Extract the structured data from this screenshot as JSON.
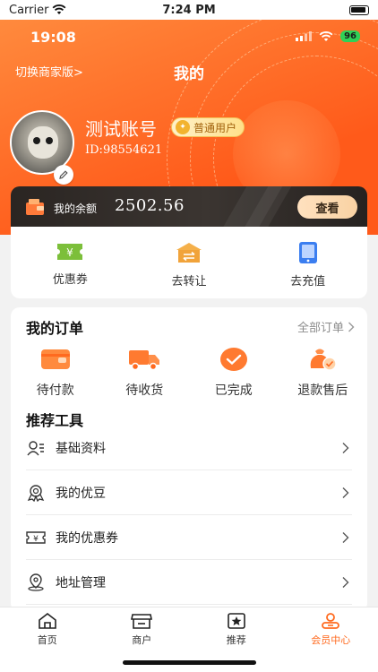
{
  "simulator": {
    "carrier": "Carrier",
    "time": "7:24 PM"
  },
  "inner_status": {
    "time": "19:08",
    "battery": "96"
  },
  "header": {
    "switch_link": "切换商家版>",
    "title": "我的"
  },
  "user": {
    "name": "测试账号",
    "badge": "普通用户",
    "id": "ID:98554621"
  },
  "balance": {
    "label": "我的余额",
    "value": "2502.56",
    "view_button": "查看"
  },
  "quick_actions": [
    {
      "label": "优惠券",
      "icon": "coupon-icon"
    },
    {
      "label": "去转让",
      "icon": "transfer-icon"
    },
    {
      "label": "去充值",
      "icon": "recharge-icon"
    }
  ],
  "orders": {
    "title": "我的订单",
    "all_link": "全部订单",
    "items": [
      {
        "label": "待付款",
        "icon": "wallet-icon"
      },
      {
        "label": "待收货",
        "icon": "truck-icon"
      },
      {
        "label": "已完成",
        "icon": "check-icon"
      },
      {
        "label": "退款售后",
        "icon": "refund-icon"
      }
    ]
  },
  "tools": {
    "title": "推荐工具",
    "items": [
      {
        "label": "基础资料",
        "icon": "profile-icon"
      },
      {
        "label": "我的优豆",
        "icon": "medal-icon"
      },
      {
        "label": "我的优惠券",
        "icon": "ticket-icon"
      },
      {
        "label": "地址管理",
        "icon": "location-icon"
      }
    ]
  },
  "tabbar": {
    "items": [
      {
        "label": "首页",
        "icon": "home-icon",
        "active": false
      },
      {
        "label": "商户",
        "icon": "store-icon",
        "active": false
      },
      {
        "label": "推荐",
        "icon": "star-icon",
        "active": false
      },
      {
        "label": "会员中心",
        "icon": "member-icon",
        "active": true
      }
    ]
  },
  "colors": {
    "accent": "#ff6a1f",
    "header_start": "#ff8a3d",
    "header_end": "#ff5a1a",
    "balance_bg": "#2a2522",
    "gold": "#f2b32e"
  }
}
